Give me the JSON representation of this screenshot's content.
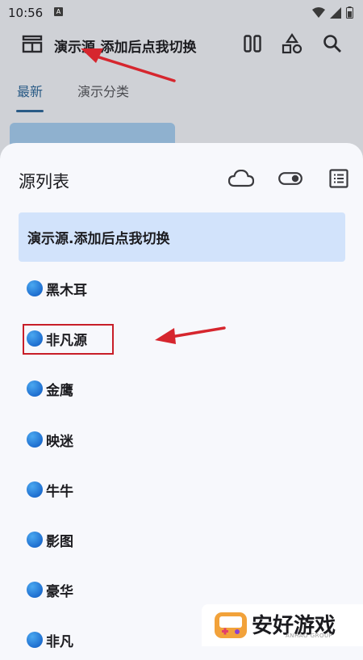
{
  "status_bar": {
    "time": "10:56",
    "badge": "A"
  },
  "app_bar": {
    "title": "演示源.添加后点我切换"
  },
  "tabs": [
    {
      "label": "最新",
      "active": true
    },
    {
      "label": "演示分类",
      "active": false
    }
  ],
  "sheet": {
    "title": "源列表",
    "selected_source": "演示源.添加后点我切换",
    "sources": [
      "黑木耳",
      "非凡源",
      "金鹰",
      "映迷",
      "牛牛",
      "影图",
      "豪华",
      "非凡"
    ],
    "highlighted_source": "非凡源"
  },
  "watermark": {
    "text": "安好游戏",
    "sub": "ANHAO GROUP"
  },
  "colors": {
    "accent": "#2a5b86",
    "selected_bg": "#d2e3fb",
    "annotation_red": "#c81e28"
  }
}
